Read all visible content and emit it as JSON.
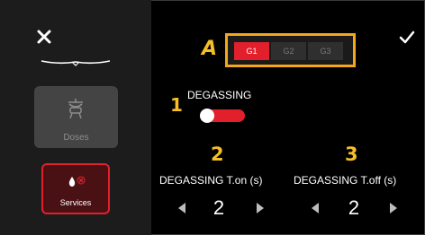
{
  "sidebar": {
    "close_icon": "close-icon",
    "tiles": [
      {
        "label": "Doses",
        "icon": "doses-icon",
        "state": "disabled"
      },
      {
        "label": "Services",
        "icon": "water-drop-icon",
        "state": "selected"
      }
    ]
  },
  "header": {
    "confirm_icon": "check-icon"
  },
  "groups": {
    "badge": "A",
    "items": [
      "G1",
      "G2",
      "G3"
    ],
    "selected": "G1"
  },
  "degassing": {
    "badge": "1",
    "label": "DEGASSING",
    "enabled": true
  },
  "params": [
    {
      "badge": "2",
      "label": "DEGASSING T.on (s)",
      "value": "2"
    },
    {
      "badge": "3",
      "label": "DEGASSING T.off (s)",
      "value": "2"
    }
  ],
  "colors": {
    "accent": "#e1202c",
    "highlight": "#f6a61b",
    "badge": "#f6bf26",
    "sidebar": "#1c1c1c",
    "background": "#000000"
  }
}
